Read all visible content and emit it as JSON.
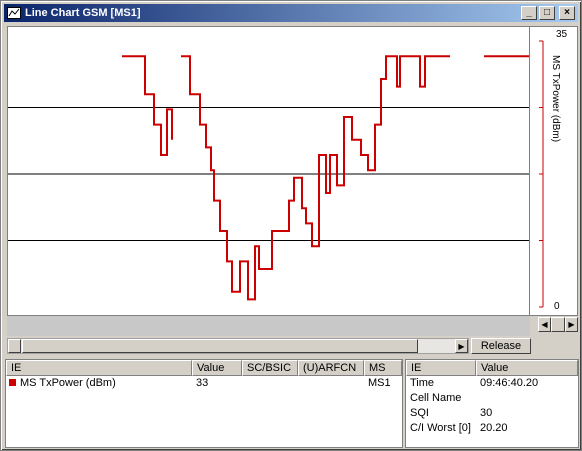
{
  "window": {
    "title": "Line Chart GSM [MS1]",
    "buttons": {
      "minimize": "_",
      "maximize": "□",
      "close": "×"
    }
  },
  "chart_data": {
    "type": "line",
    "ylabel": "MS TxPower (dBm)",
    "ylim": [
      0,
      35
    ],
    "yticks": [
      "35",
      "0"
    ],
    "gridlines": [
      8.75,
      17.5,
      26.25
    ],
    "grid": true,
    "series": [
      {
        "name": "MS TxPower (dBm)",
        "color": "#cc0000",
        "segments": [
          [
            [
              114,
              33
            ],
            [
              137,
              33
            ],
            [
              137,
              28
            ],
            [
              146,
              28
            ],
            [
              146,
              24
            ],
            [
              153,
              24
            ],
            [
              153,
              20
            ],
            [
              159,
              20
            ],
            [
              159,
              26
            ],
            [
              164,
              26
            ],
            [
              164,
              22
            ]
          ],
          [
            [
              173,
              33
            ],
            [
              182,
              33
            ],
            [
              182,
              28
            ],
            [
              192,
              28
            ],
            [
              192,
              24
            ],
            [
              198,
              24
            ],
            [
              198,
              21
            ],
            [
              203,
              21
            ],
            [
              203,
              18
            ],
            [
              206,
              18
            ],
            [
              206,
              14
            ],
            [
              212,
              14
            ],
            [
              212,
              10
            ],
            [
              219,
              10
            ],
            [
              219,
              6
            ],
            [
              224,
              6
            ],
            [
              224,
              2
            ],
            [
              232,
              2
            ],
            [
              232,
              6
            ],
            [
              240,
              6
            ],
            [
              240,
              1
            ],
            [
              247,
              1
            ],
            [
              247,
              8
            ],
            [
              251,
              8
            ],
            [
              251,
              5
            ],
            [
              264,
              5
            ],
            [
              264,
              10
            ],
            [
              281,
              10
            ],
            [
              281,
              14
            ],
            [
              286,
              14
            ],
            [
              286,
              17
            ],
            [
              294,
              17
            ],
            [
              294,
              13
            ],
            [
              298,
              13
            ],
            [
              298,
              11
            ],
            [
              304,
              11
            ],
            [
              304,
              8
            ],
            [
              311,
              8
            ],
            [
              311,
              20
            ],
            [
              318,
              20
            ],
            [
              318,
              15
            ],
            [
              322,
              15
            ],
            [
              322,
              20
            ],
            [
              329,
              20
            ],
            [
              329,
              16
            ],
            [
              336,
              16
            ],
            [
              336,
              25
            ],
            [
              344,
              25
            ],
            [
              344,
              22
            ],
            [
              353,
              22
            ],
            [
              353,
              20
            ],
            [
              360,
              20
            ],
            [
              360,
              18
            ],
            [
              367,
              18
            ],
            [
              367,
              24
            ],
            [
              373,
              24
            ],
            [
              373,
              30
            ],
            [
              378,
              30
            ],
            [
              378,
              33
            ],
            [
              389,
              33
            ],
            [
              389,
              29
            ],
            [
              392,
              29
            ],
            [
              392,
              33
            ],
            [
              397,
              33
            ],
            [
              397,
              33
            ],
            [
              412,
              33
            ],
            [
              412,
              29
            ],
            [
              417,
              29
            ],
            [
              417,
              33
            ],
            [
              442,
              33
            ]
          ],
          [
            [
              476,
              33
            ],
            [
              523,
              33
            ]
          ]
        ]
      }
    ]
  },
  "scroll": {
    "release_label": "Release"
  },
  "table": {
    "columns": [
      "IE",
      "Value",
      "SC/BSIC",
      "(U)ARFCN",
      "MS"
    ],
    "rows": [
      {
        "ie": "MS TxPower (dBm)",
        "value": "33",
        "sc_bsic": "",
        "uarfcn": "",
        "ms": "MS1",
        "color": "#cc0000"
      }
    ]
  },
  "info": {
    "columns": [
      "IE",
      "Value"
    ],
    "rows": [
      {
        "ie": "Time",
        "value": "09:46:40.20"
      },
      {
        "ie": "Cell Name",
        "value": ""
      },
      {
        "ie": "SQI",
        "value": "30"
      },
      {
        "ie": "C/I Worst [0]",
        "value": "20.20"
      }
    ]
  }
}
